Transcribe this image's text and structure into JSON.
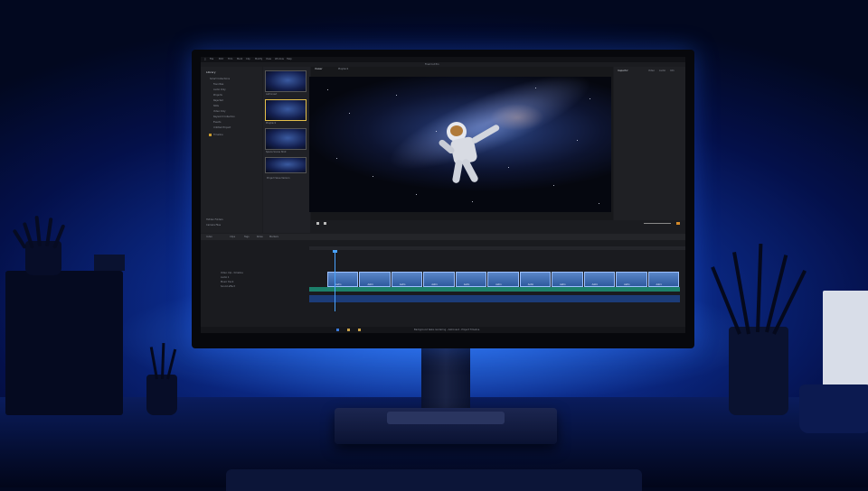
{
  "app": {
    "menu": [
      "File",
      "Edit",
      "Trim",
      "Mark",
      "Clip",
      "Modify",
      "View",
      "Window",
      "Help"
    ],
    "window_title": "Final Cut Pro"
  },
  "project_panel": {
    "library": "Library",
    "items": [
      "Smart Collections",
      "Favorites",
      "Audio Only",
      "Projects",
      "Rejected",
      "Stills",
      "Video Only",
      "Keyword Collection",
      "Events",
      "Untitled Project",
      "Timeline"
    ],
    "footer": [
      "Hidden Folders",
      "Camera Files"
    ]
  },
  "media_panel": {
    "clip1": "Astronaut",
    "clip2": "Playback",
    "clip3": "Space Scene Shot",
    "footer": "Project Save Version"
  },
  "viewer": {
    "tab1": "Viewer",
    "tab2": "Playback"
  },
  "inspector": {
    "title": "Inspector",
    "tabs": [
      "Video",
      "Audio",
      "Info"
    ]
  },
  "timeline": {
    "index": "Index",
    "tabs": [
      "Clips",
      "Tags",
      "Roles",
      "Markers"
    ],
    "tracks": [
      {
        "name": "Video clip - timeline",
        "type": "video"
      },
      {
        "name": "Audio 1",
        "type": "audio"
      },
      {
        "name": "Music track",
        "type": "audio"
      },
      {
        "name": "Sound effect",
        "type": "audio"
      }
    ],
    "clip_count": 11,
    "clip_label": "Astro"
  },
  "taskbar": {
    "status": "Background tasks rendering - Astronaut - Project Timeline"
  },
  "colors": {
    "room_blue": "#1a55d8",
    "ui_dark": "#1b1c20",
    "clip_blue": "#5a86c8",
    "audio_green": "#1c7f6a",
    "playhead": "#4aa3ff"
  }
}
